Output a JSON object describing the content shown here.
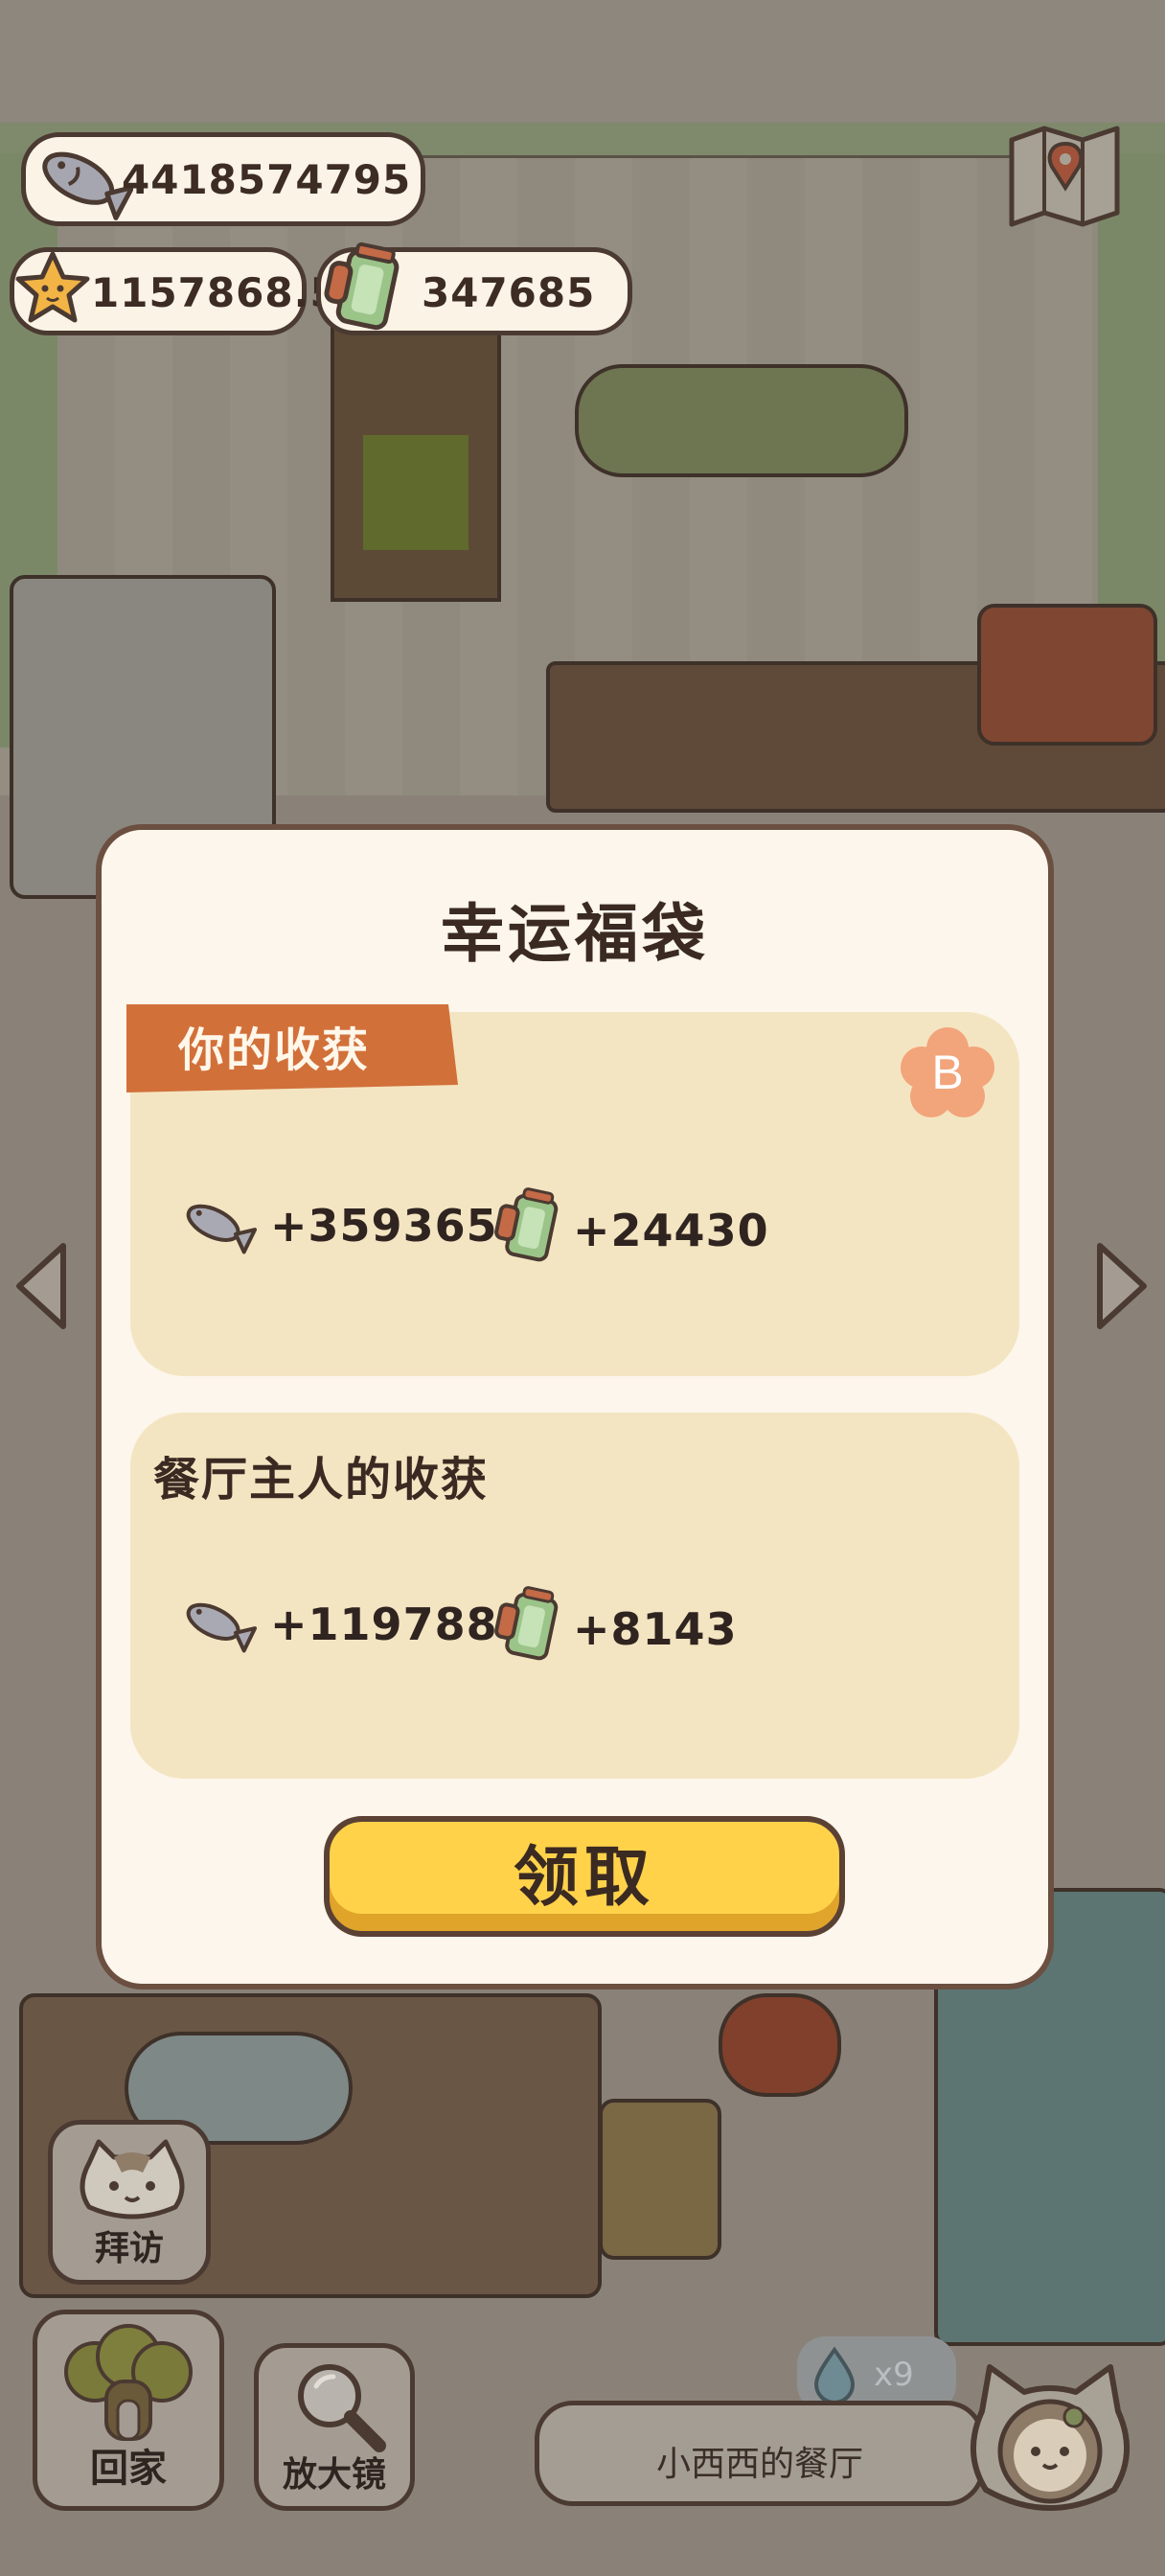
{
  "hud": {
    "fish_count": "4418574795",
    "star_count": "1157868.5",
    "cup_count": "347685",
    "map_icon": "map-icon"
  },
  "dialog": {
    "title": "幸运福袋",
    "your_section": {
      "label": "你的收获",
      "grade": "B",
      "fish_reward": "+359365",
      "cup_reward": "+24430"
    },
    "owner_section": {
      "label": "餐厅主人的收获",
      "fish_reward": "+119788",
      "cup_reward": "+8143"
    },
    "claim_label": "领取"
  },
  "nav": {
    "visit_label": "拜访",
    "home_label": "回家",
    "magnify_label": "放大镜",
    "restaurant_name": "小西西的餐厅",
    "drop_count": "x9"
  },
  "colors": {
    "accent_orange": "#d2703a",
    "button_yellow": "#ffd24a",
    "panel_beige": "#f4e5c2",
    "dialog_bg": "#fcf6ec",
    "outline_brown": "#4b3a31"
  }
}
